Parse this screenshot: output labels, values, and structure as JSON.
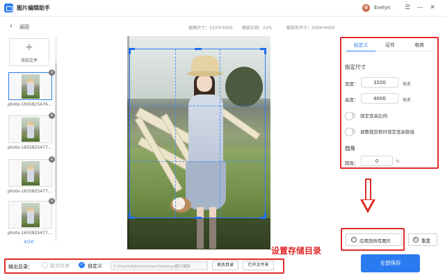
{
  "app": {
    "title": "图片编辑助手",
    "username": "Evelyn"
  },
  "window_controls": {
    "menu": "☰",
    "minimize": "—",
    "close": "✕"
  },
  "header": {
    "back_label": "返回",
    "original_size": "原图尺寸：3333*5000",
    "scale": "缩放比例：22%",
    "cropped_size": "裁剪后尺寸：3200*4000"
  },
  "sidebar": {
    "add_file_label": "添加文件",
    "files": [
      {
        "name": "photo-1655825476..."
      },
      {
        "name": "photo-1655825477..."
      },
      {
        "name": "photo-1655825477..."
      },
      {
        "name": "photo-1655825477..."
      }
    ],
    "page_count": "4/50"
  },
  "settings": {
    "tabs": [
      {
        "label": "自定义"
      },
      {
        "label": "证件"
      },
      {
        "label": "电商"
      }
    ],
    "active_tab": 0,
    "size_section_title": "指定尺寸",
    "width_label": "宽度：",
    "width_value": "3200",
    "height_label": "高度：",
    "height_value": "4000",
    "unit_px": "像素",
    "lock_ratio_label": "锁定宽高比例",
    "lock_value_label": "调整裁剪框时锁定宽高数值",
    "corner_section_title": "圆角",
    "corner_label": "圆角：",
    "corner_value": "0",
    "unit_percent": "%"
  },
  "actions": {
    "apply_all_label": "应用到所有图片",
    "reset_label": "重置",
    "save_all_label": "全部保存"
  },
  "output": {
    "label": "输出目录：",
    "option_original": "原文件夹",
    "option_custom": "自定义",
    "path": "C:\\Users\\Administrator\\Desktop\\图片编辑",
    "change_dir_label": "更改目录",
    "open_folder_label": "打开文件夹"
  },
  "annotation": {
    "text": "设置存储目录"
  },
  "colors": {
    "accent": "#2b7bf0",
    "annotation_red": "#e12a2a"
  }
}
